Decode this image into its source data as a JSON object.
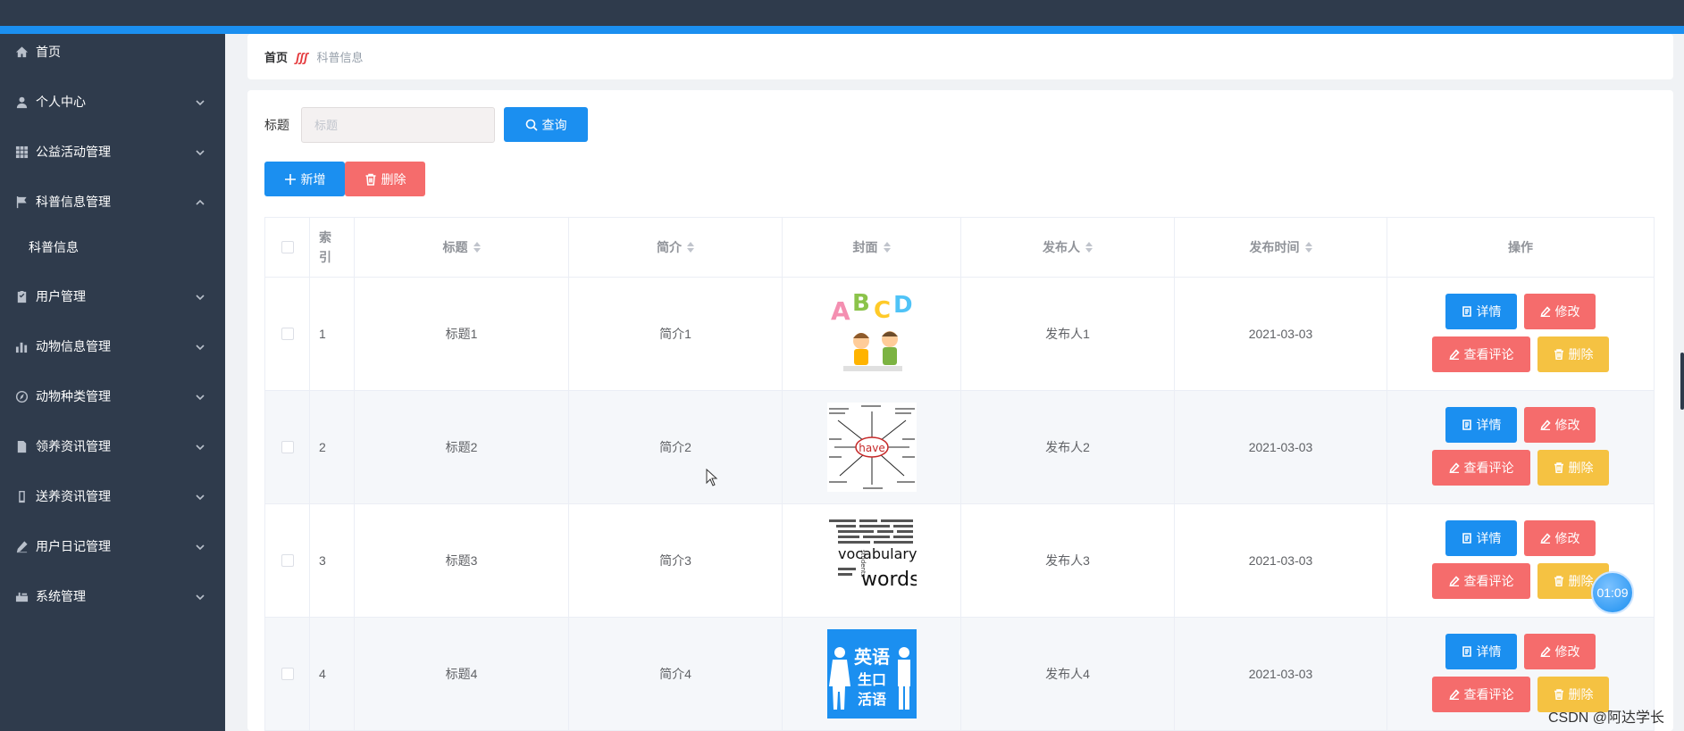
{
  "sidebar": {
    "items": [
      {
        "label": "首页",
        "icon": "home-icon",
        "expandable": false
      },
      {
        "label": "个人中心",
        "icon": "user-icon",
        "expandable": true
      },
      {
        "label": "公益活动管理",
        "icon": "grid-icon",
        "expandable": true
      },
      {
        "label": "科普信息管理",
        "icon": "flag-icon",
        "expandable": true,
        "expanded": true
      },
      {
        "label": "用户管理",
        "icon": "clipboard-icon",
        "expandable": true
      },
      {
        "label": "动物信息管理",
        "icon": "bar-chart-icon",
        "expandable": true
      },
      {
        "label": "动物种类管理",
        "icon": "compass-icon",
        "expandable": true
      },
      {
        "label": "领养资讯管理",
        "icon": "document-icon",
        "expandable": true
      },
      {
        "label": "送养资讯管理",
        "icon": "phone-icon",
        "expandable": true
      },
      {
        "label": "用户日记管理",
        "icon": "pen-icon",
        "expandable": true
      },
      {
        "label": "系统管理",
        "icon": "settings-icon",
        "expandable": true
      }
    ],
    "subitem": "科普信息"
  },
  "breadcrumb": {
    "home": "首页",
    "current": "科普信息",
    "separator_icon": "fire-icon"
  },
  "search": {
    "label": "标题",
    "placeholder": "标题",
    "query_label": "查询"
  },
  "toolbar": {
    "add_label": "新增",
    "delete_label": "删除"
  },
  "table": {
    "headers": {
      "index": "索引",
      "title": "标题",
      "intro": "简介",
      "cover": "封面",
      "publisher": "发布人",
      "time": "发布时间",
      "ops": "操作"
    },
    "rows": [
      {
        "index": "1",
        "title": "标题1",
        "intro": "简介1",
        "cover": "abcd-kids-image",
        "publisher": "发布人1",
        "time": "2021-03-03"
      },
      {
        "index": "2",
        "title": "标题2",
        "intro": "简介2",
        "cover": "have-mindmap-image",
        "publisher": "发布人2",
        "time": "2021-03-03"
      },
      {
        "index": "3",
        "title": "标题3",
        "intro": "简介3",
        "cover": "vocabulary-words-image",
        "publisher": "发布人3",
        "time": "2021-03-03"
      },
      {
        "index": "4",
        "title": "标题4",
        "intro": "简介4",
        "cover": "english-oral-image",
        "publisher": "发布人4",
        "time": "2021-03-03"
      }
    ],
    "actions": {
      "detail": "详情",
      "edit": "修改",
      "comment": "查看评论",
      "delete": "删除"
    }
  },
  "covers": {
    "abcd": {
      "letters": [
        "A",
        "B",
        "C",
        "D"
      ]
    },
    "have": {
      "center": "have"
    },
    "vocab": {
      "line1": "vocabulary",
      "line2": "words",
      "side": "students"
    },
    "oral": {
      "line1": "英语",
      "line2": "生口",
      "line3": "活语"
    }
  },
  "timer": "01:09",
  "watermark": "CSDN @阿达学长",
  "colors": {
    "primary": "#1b8ff0",
    "danger": "#f56c6c",
    "warning": "#f5c242",
    "sidebar": "#2f3b4c"
  }
}
